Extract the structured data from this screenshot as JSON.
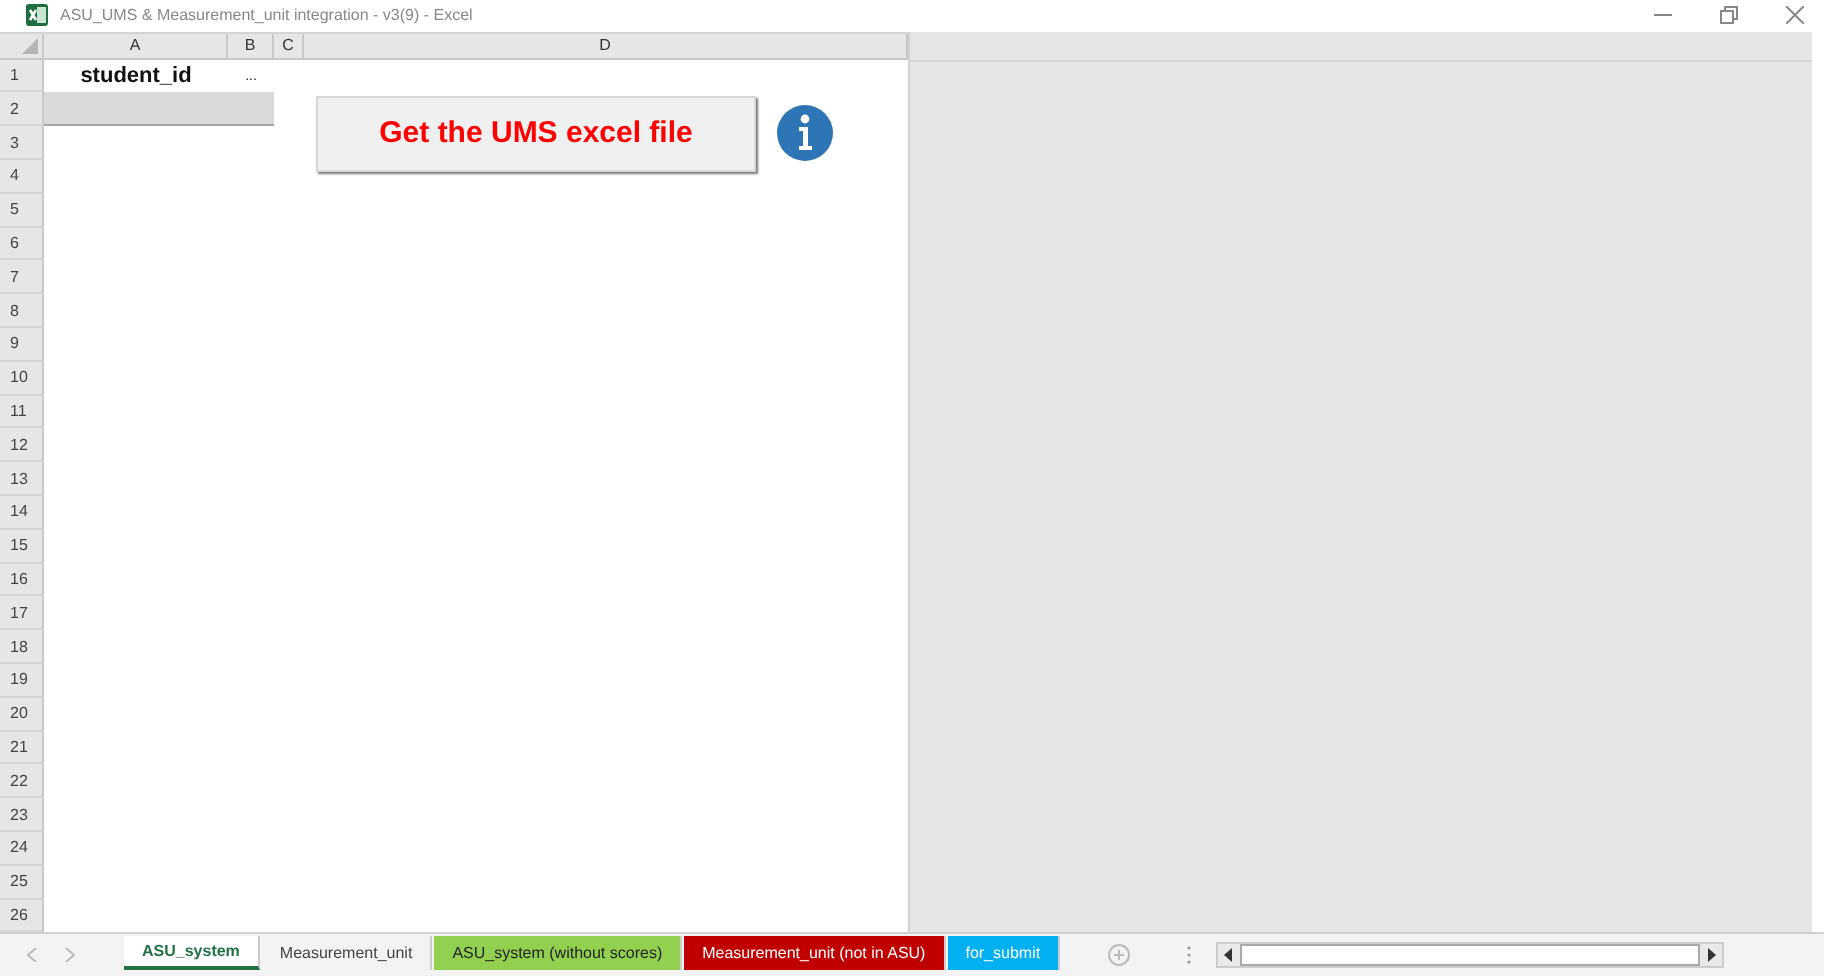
{
  "window": {
    "title": "ASU_UMS & Measurement_unit integration - v3(9) - Excel"
  },
  "columns": [
    "A",
    "B",
    "C",
    "D"
  ],
  "rows": [
    {
      "number": "1",
      "cells": [
        {
          "text": "student_id",
          "bold": true
        },
        {
          "text": "..."
        }
      ]
    },
    {
      "number": "2",
      "cells": [
        {
          "shaded": true
        },
        {
          "shaded": true
        }
      ]
    },
    {
      "number": "3"
    },
    {
      "number": "4"
    },
    {
      "number": "5"
    },
    {
      "number": "6"
    },
    {
      "number": "7"
    },
    {
      "number": "8"
    },
    {
      "number": "9"
    },
    {
      "number": "10"
    },
    {
      "number": "11"
    },
    {
      "number": "12"
    },
    {
      "number": "13"
    },
    {
      "number": "14"
    },
    {
      "number": "15"
    },
    {
      "number": "16"
    },
    {
      "number": "17"
    },
    {
      "number": "18"
    },
    {
      "number": "19"
    },
    {
      "number": "20"
    },
    {
      "number": "21"
    },
    {
      "number": "22"
    },
    {
      "number": "23"
    },
    {
      "number": "24"
    },
    {
      "number": "25"
    },
    {
      "number": "26"
    }
  ],
  "sheet_button": {
    "label": "Get the UMS excel file"
  },
  "sheet_tabs": [
    {
      "label": "ASU_system",
      "selected": true
    },
    {
      "label": "Measurement_unit",
      "selected": false
    },
    {
      "label": "ASU_system (without scores)",
      "selected": false,
      "color": "#92d050"
    },
    {
      "label": "Measurement_unit (not in ASU)",
      "selected": false,
      "color": "#c00000"
    },
    {
      "label": "for_submit",
      "selected": false,
      "color": "#00b0f0"
    }
  ]
}
